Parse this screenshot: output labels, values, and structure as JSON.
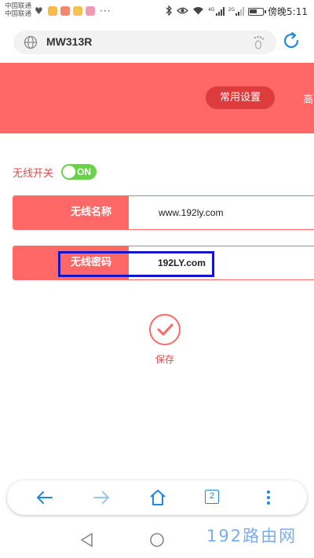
{
  "status_bar": {
    "carrier_1": "中国联通",
    "carrier_2": "中国联通",
    "more": "···",
    "time": "傍晚5:11",
    "network_1": "4G",
    "network_2": "2G"
  },
  "browser": {
    "url": "MW313R"
  },
  "header": {
    "active_tab": "常用设置",
    "next_tab": "高"
  },
  "wifi": {
    "switch_label": "无线开关",
    "switch_state": "ON",
    "ssid_label": "无线名称",
    "ssid_value": "www.192ly.com",
    "password_label": "无线密码",
    "password_value": "192LY.com"
  },
  "save": {
    "label": "保存"
  },
  "bottom_nav": {
    "tab_count": "2"
  },
  "watermark": "192路由网",
  "colors": {
    "brand_red": "#ff6866",
    "active_pill": "#de3b3d",
    "toggle_green": "#6ad14b",
    "highlight_blue": "#1616c8",
    "browser_blue": "#1e88e5"
  }
}
